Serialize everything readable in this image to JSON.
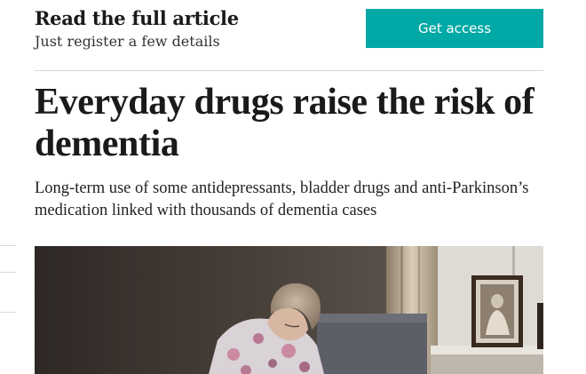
{
  "access_bar": {
    "title": "Read the full article",
    "subtitle": "Just register a few details",
    "button_label": "Get access",
    "button_color": "#00a9a6"
  },
  "article": {
    "headline": "Everyday drugs raise the risk of dementia",
    "standfirst": "Long-term use of some antidepressants, bladder drugs and anti-Parkinson’s medication linked with thousands of dementia cases"
  },
  "lead_image": {
    "icon": "photo-elderly-woman-seated"
  }
}
